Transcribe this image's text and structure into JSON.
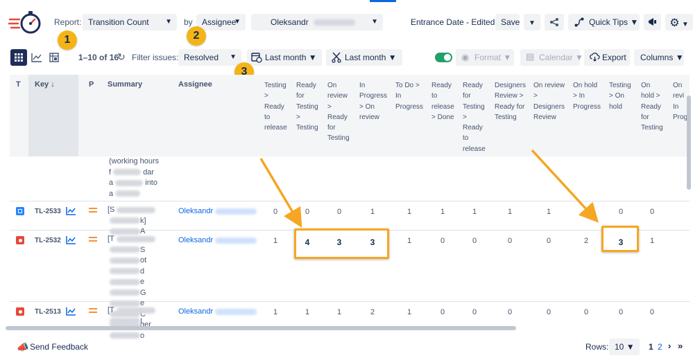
{
  "toolbar": {
    "report_label": "Report:",
    "report_value": "Transition Count",
    "by_label": "by",
    "group_value": "Assignee",
    "user_value": "Oleksandr",
    "date_label": "Entrance Date - Edited",
    "save_label": "Save",
    "quick_tips_label": "Quick Tips"
  },
  "filters": {
    "pagination": "1–10 of 16",
    "filter_label": "Filter issues:",
    "filter_value": "Resolved",
    "date_range_1": "Last month",
    "date_range_2": "Last month",
    "format_label": "Format",
    "calendar_label": "Calendar",
    "export_label": "Export",
    "columns_label": "Columns"
  },
  "badges": [
    "1",
    "2",
    "3"
  ],
  "table": {
    "headers": {
      "t": "T",
      "key": "Key",
      "p": "P",
      "summary": "Summary",
      "assignee": "Assignee"
    },
    "transition_headers": [
      [
        "Testing",
        ">",
        "Ready",
        "to",
        "release"
      ],
      [
        "Ready",
        "for",
        "Testing",
        ">",
        "Testing"
      ],
      [
        "On",
        "review",
        ">",
        "Ready",
        "for",
        "Testing"
      ],
      [
        "In",
        "Progress",
        "> On",
        "review"
      ],
      [
        "To Do >",
        "In",
        "Progress"
      ],
      [
        "Ready",
        "to",
        "release",
        "> Done"
      ],
      [
        "Ready",
        "for",
        "Testing",
        ">",
        "Ready",
        "to",
        "release"
      ],
      [
        "Designers",
        "Review >",
        "Ready for",
        "Testing"
      ],
      [
        "On review",
        ">",
        "Designers",
        "Review"
      ],
      [
        "On hold",
        "> In",
        "Progress"
      ],
      [
        "Testing",
        "> On",
        "hold"
      ],
      [
        "On",
        "hold >",
        "Ready",
        "for",
        "Testing"
      ],
      [
        "On",
        "revi",
        "In",
        "Prog"
      ]
    ],
    "partial_summary": [
      "(working hours",
      "f",
      "dar",
      "a",
      "into",
      "a"
    ],
    "rows": [
      {
        "key": "TL-2533",
        "type_color": "#2684ff",
        "summary_lines": [
          "[S",
          "k]",
          "A"
        ],
        "assignee": "Oleksandr",
        "values": [
          "0",
          "0",
          "0",
          "1",
          "1",
          "1",
          "1",
          "1",
          "1",
          "",
          "0",
          "0"
        ]
      },
      {
        "key": "TL-2532",
        "type_color": "#e5493a",
        "summary_lines": [
          "[T",
          "S",
          "ot",
          "d",
          "e",
          "G",
          "e",
          "C",
          "ger",
          "o"
        ],
        "assignee": "Oleksandr",
        "values": [
          "1",
          "4",
          "3",
          "3",
          "1",
          "0",
          "0",
          "0",
          "0",
          "2",
          "3",
          "1"
        ]
      },
      {
        "key": "TL-2513",
        "type_color": "#e5493a",
        "summary_lines": [
          "[T",
          "I"
        ],
        "assignee": "Oleksandr",
        "values": [
          "1",
          "1",
          "1",
          "2",
          "1",
          "0",
          "0",
          "0",
          "0",
          "0",
          "0",
          "0"
        ]
      }
    ]
  },
  "footer": {
    "feedback_label": "Send Feedback",
    "rows_label": "Rows:",
    "rows_value": "10",
    "page_1": "1",
    "page_2": "2"
  },
  "colors": {
    "accent": "#0c66e4",
    "highlight": "#f5a623",
    "badge": "#f5b416",
    "toggle_on": "#22a06b",
    "priority_medium": "#f79233"
  }
}
